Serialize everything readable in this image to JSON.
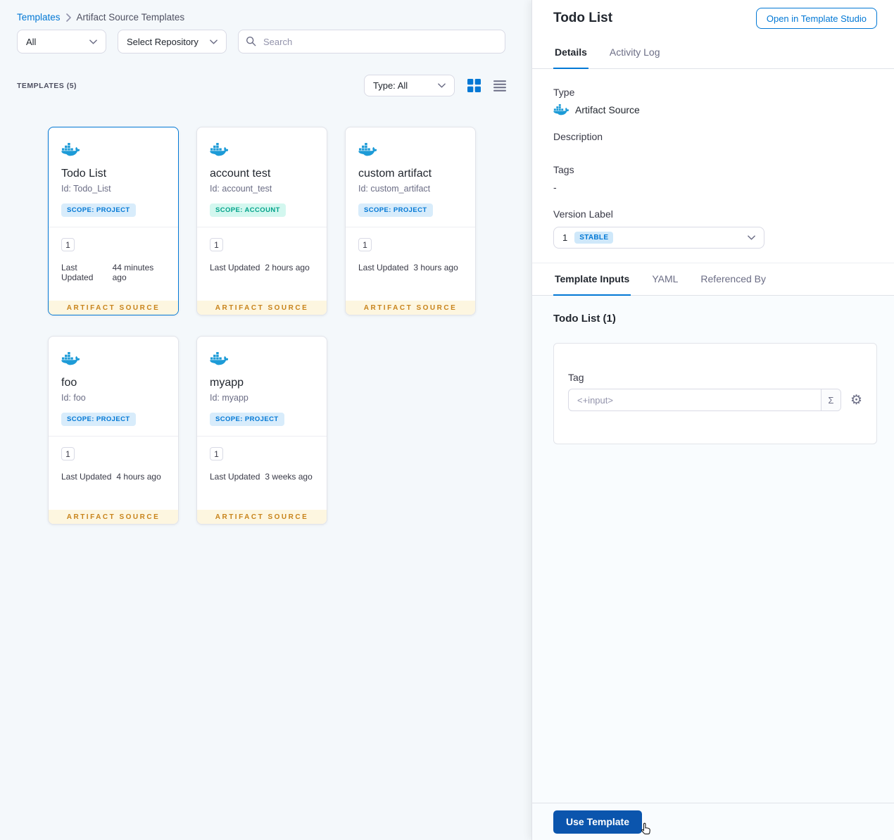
{
  "colors": {
    "accent_blue": "#0278d5",
    "docker_blue": "#1d9bd7",
    "artifact_source_amber": "#c8831a",
    "use_template_blue": "#0b55ad"
  },
  "breadcrumb": {
    "root": "Templates",
    "current": "Artifact Source Templates"
  },
  "filters": {
    "scope_select": "All",
    "repo_select": "Select Repository",
    "search_placeholder": "Search"
  },
  "toolbar": {
    "count_label": "TEMPLATES (5)",
    "type_select": "Type: All"
  },
  "cards_meta": {
    "updated_label": "Last Updated",
    "footer": "ARTIFACT SOURCE"
  },
  "cards": [
    {
      "name": "Todo List",
      "id": "Id: Todo_List",
      "scope": "SCOPE: PROJECT",
      "scope_type": "project",
      "version": "1",
      "updated": "44 minutes ago"
    },
    {
      "name": "account test",
      "id": "Id: account_test",
      "scope": "SCOPE: ACCOUNT",
      "scope_type": "account",
      "version": "1",
      "updated": "2 hours ago"
    },
    {
      "name": "custom artifact",
      "id": "Id: custom_artifact",
      "scope": "SCOPE: PROJECT",
      "scope_type": "project",
      "version": "1",
      "updated": "3 hours ago"
    },
    {
      "name": "foo",
      "id": "Id: foo",
      "scope": "SCOPE: PROJECT",
      "scope_type": "project",
      "version": "1",
      "updated": "4 hours ago"
    },
    {
      "name": "myapp",
      "id": "Id: myapp",
      "scope": "SCOPE: PROJECT",
      "scope_type": "project",
      "version": "1",
      "updated": "3 weeks ago"
    }
  ],
  "drawer": {
    "title": "Todo List",
    "open_studio_button": "Open in Template Studio",
    "tabs": {
      "details": "Details",
      "activity_log": "Activity Log"
    },
    "fields": {
      "type_label": "Type",
      "type_value": "Artifact Source",
      "description_label": "Description",
      "tags_label": "Tags",
      "tags_value": "-",
      "version_label": "Version Label",
      "version_number": "1",
      "version_badge": "STABLE"
    },
    "content_tabs": {
      "template_inputs": "Template Inputs",
      "yaml": "YAML",
      "referenced_by": "Referenced By"
    },
    "inputs": {
      "heading": "Todo List (1)",
      "tag_label": "Tag",
      "tag_placeholder": "<+input>",
      "expression_symbol": "Σ"
    },
    "use_template_button": "Use Template"
  }
}
